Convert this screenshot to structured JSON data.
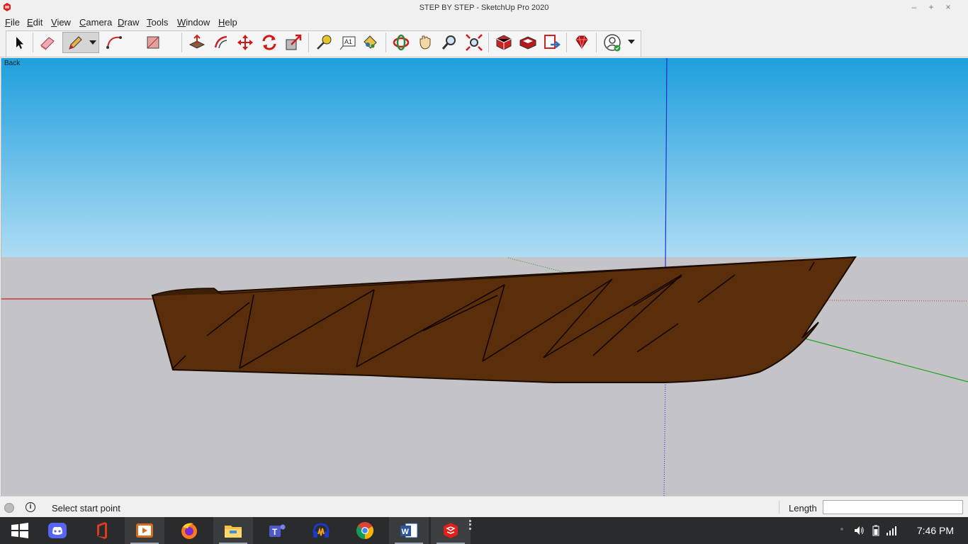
{
  "window": {
    "title": "STEP BY STEP - SketchUp Pro 2020",
    "controls": [
      "minimize",
      "maximize",
      "close"
    ]
  },
  "menu": [
    "File",
    "Edit",
    "View",
    "Camera",
    "Draw",
    "Tools",
    "Window",
    "Help"
  ],
  "toolbar": {
    "tools": [
      {
        "name": "select-tool-icon"
      },
      {
        "name": "eraser-tool-icon"
      },
      {
        "name": "pencil-tool-icon",
        "active": true
      },
      {
        "name": "arc-tool-icon"
      },
      {
        "name": "rectangle-tool-icon"
      },
      {
        "name": "push-pull-tool-icon"
      },
      {
        "name": "offset-tool-icon"
      },
      {
        "name": "move-tool-icon"
      },
      {
        "name": "rotate-tool-icon"
      },
      {
        "name": "scale-tool-icon"
      },
      {
        "name": "tape-measure-tool-icon"
      },
      {
        "name": "text-tool-icon",
        "label": "A1"
      },
      {
        "name": "paint-bucket-tool-icon"
      },
      {
        "name": "orbit-tool-icon"
      },
      {
        "name": "pan-tool-icon"
      },
      {
        "name": "zoom-tool-icon"
      },
      {
        "name": "zoom-extents-tool-icon"
      },
      {
        "name": "3d-warehouse-icon"
      },
      {
        "name": "extension-warehouse-icon"
      },
      {
        "name": "send-to-layout-icon"
      },
      {
        "name": "extension-manager-icon"
      },
      {
        "name": "account-icon"
      }
    ]
  },
  "viewport": {
    "scene_label": "Back",
    "sky_top_color": "#1e9fdd",
    "sky_bottom_color": "#aedcf3",
    "ground_color": "#c3c3c8",
    "hull_color": "#5a2e0a"
  },
  "status": {
    "message": "Select start point",
    "vcb_label": "Length",
    "vcb_value": ""
  },
  "taskbar": {
    "apps": [
      {
        "name": "windows-start-icon"
      },
      {
        "name": "discord-icon"
      },
      {
        "name": "office-icon"
      },
      {
        "name": "video-app-icon"
      },
      {
        "name": "firefox-icon"
      },
      {
        "name": "file-explorer-icon"
      },
      {
        "name": "teams-icon"
      },
      {
        "name": "audio-app-icon"
      },
      {
        "name": "chrome-icon"
      },
      {
        "name": "word-icon"
      },
      {
        "name": "sketchup-icon"
      }
    ],
    "clock": "7:46 PM"
  }
}
